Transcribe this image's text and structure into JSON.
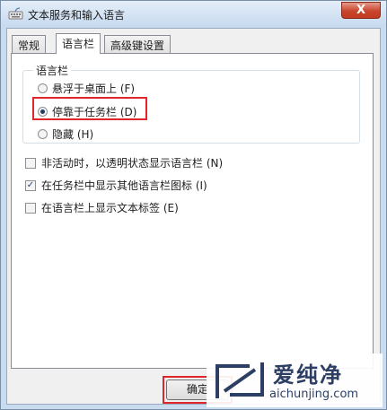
{
  "window": {
    "title": "文本服务和输入语言",
    "close_label": "X"
  },
  "tabs": [
    {
      "label": "常规"
    },
    {
      "label": "语言栏"
    },
    {
      "label": "高级键设置"
    }
  ],
  "language_bar": {
    "group_title": "语言栏",
    "options": [
      {
        "label": "悬浮于桌面上 (F)",
        "selected": false
      },
      {
        "label": "停靠于任务栏 (D)",
        "selected": true
      },
      {
        "label": "隐藏 (H)",
        "selected": false
      }
    ]
  },
  "checkboxes": [
    {
      "label": "非活动时，以透明状态显示语言栏 (N)",
      "checked": false
    },
    {
      "label": "在任务栏中显示其他语言栏图标 (I)",
      "checked": true
    },
    {
      "label": "在语言栏上显示文本标签 (E)",
      "checked": false
    }
  ],
  "buttons": {
    "ok": "确定"
  },
  "watermark": {
    "brand": "爱纯净",
    "url": "aichunjing.com"
  },
  "colors": {
    "highlight": "#e0262d",
    "accent": "#1e3c64"
  }
}
